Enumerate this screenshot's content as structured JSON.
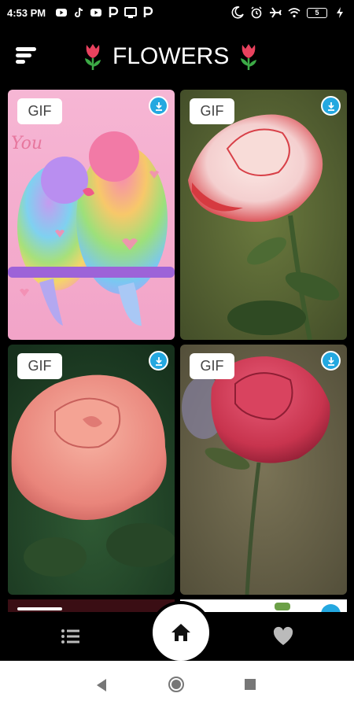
{
  "status_bar": {
    "time": "4:53 PM",
    "left_icons": [
      "youtube-icon",
      "tiktok-icon",
      "youtube-icon",
      "paytm-icon",
      "tv-icon",
      "paytm-icon"
    ],
    "right_icons": [
      "moon-icon",
      "alarm-icon",
      "airplane-icon",
      "wifi-icon",
      "battery-icon",
      "charging-icon"
    ],
    "battery_level": "5"
  },
  "header": {
    "title": "FLOWERS",
    "menu_icon": "menu-icon"
  },
  "cards": [
    {
      "badge": "GIF",
      "subject": "rainbow lovebirds",
      "action_icon": "download-icon"
    },
    {
      "badge": "GIF",
      "subject": "white-red rose",
      "action_icon": "download-icon"
    },
    {
      "badge": "GIF",
      "subject": "peach rose",
      "action_icon": "download-icon"
    },
    {
      "badge": "GIF",
      "subject": "red rose",
      "action_icon": "download-icon"
    }
  ],
  "bottom_nav": {
    "items": [
      "list-icon",
      "home-icon",
      "heart-icon"
    ],
    "active": "home-icon"
  },
  "system_nav": {
    "items": [
      "back-icon",
      "home-icon",
      "recents-icon"
    ]
  },
  "colors": {
    "background": "#000000",
    "accent": "#24a8e0",
    "badge_bg": "#ffffff",
    "tulip_red": "#e8425e",
    "tulip_green": "#3caa46"
  }
}
